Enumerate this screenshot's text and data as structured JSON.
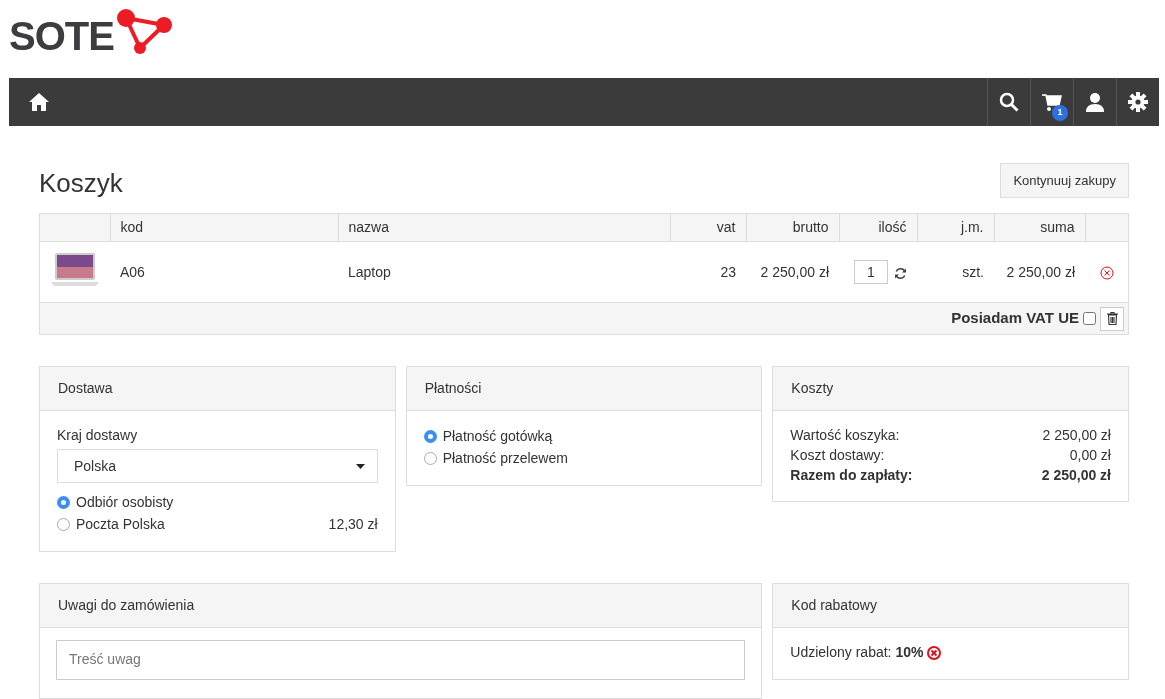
{
  "logo": {
    "text": "SOTE"
  },
  "navbar": {
    "cart_count": "1"
  },
  "page_title": "Koszyk",
  "continue_button": "Kontynuuj zakupy",
  "cart": {
    "columns": [
      "kod",
      "nazwa",
      "vat",
      "brutto",
      "ilość",
      "j.m.",
      "suma"
    ],
    "rows": [
      {
        "code": "A06",
        "name": "Laptop",
        "vat": "23",
        "gross": "2 250,00 zł",
        "quantity": "1",
        "unit": "szt.",
        "total": "2 250,00 zł"
      }
    ],
    "vat_ue": {
      "label": "Posiadam VAT UE",
      "checked": false
    }
  },
  "delivery": {
    "title": "Dostawa",
    "country_label": "Kraj dostawy",
    "country": "Polska",
    "options": [
      {
        "label": "Odbiór osobisty",
        "selected": true
      },
      {
        "label": "Poczta Polska",
        "price": "12,30 zł",
        "selected": false
      }
    ]
  },
  "payment": {
    "title": "Płatności",
    "options": [
      {
        "label": "Płatność gotówką",
        "selected": true
      },
      {
        "label": "Płatność przelewem",
        "selected": false
      }
    ]
  },
  "costs": {
    "title": "Koszty",
    "lines": [
      {
        "label": "Wartość koszyka:",
        "value": "2 250,00 zł",
        "kind": "normal"
      },
      {
        "label": "Koszt dostawy:",
        "value": "0,00 zł",
        "kind": "normal"
      },
      {
        "label": "Razem do zapłaty:",
        "value": "2 250,00 zł",
        "kind": "total"
      }
    ]
  },
  "notes": {
    "title": "Uwagi do zamówienia",
    "placeholder": "Treść uwag"
  },
  "discount": {
    "title": "Kod rabatowy",
    "text": "Udzielony rabat: **10%**"
  }
}
